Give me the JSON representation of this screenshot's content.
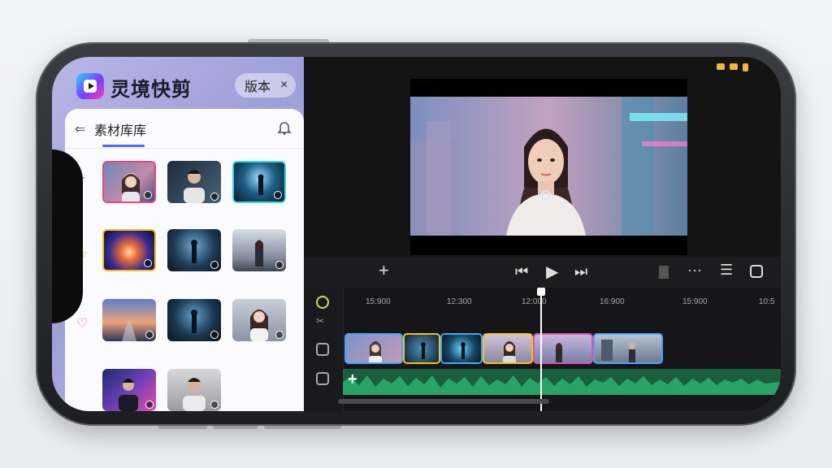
{
  "app": {
    "title": "灵境快剪",
    "badge": "版本",
    "close_glyph": "×",
    "logo_icon": "play-logo-icon"
  },
  "library": {
    "back_glyph": "⇐",
    "title": "素材库库",
    "notify_icon": "bell-icon",
    "thumbnails": [
      {
        "row": 0,
        "col": 0,
        "subject": "woman-portrait",
        "border": "#e9477c"
      },
      {
        "row": 0,
        "col": 1,
        "subject": "man-portrait",
        "border": ""
      },
      {
        "row": 0,
        "col": 2,
        "subject": "figure-neon",
        "border": "#39d6e8"
      },
      {
        "row": 1,
        "col": 0,
        "subject": "light-burst",
        "border": "#f2c21b"
      },
      {
        "row": 1,
        "col": 1,
        "subject": "figure-tunnel",
        "border": ""
      },
      {
        "row": 1,
        "col": 2,
        "subject": "woman-street",
        "border": ""
      },
      {
        "row": 2,
        "col": 0,
        "subject": "road-sunset",
        "border": ""
      },
      {
        "row": 2,
        "col": 1,
        "subject": "figure-tunnel-2",
        "border": ""
      },
      {
        "row": 2,
        "col": 2,
        "subject": "woman-smile",
        "border": ""
      },
      {
        "row": 3,
        "col": 0,
        "subject": "man-headset",
        "border": ""
      },
      {
        "row": 3,
        "col": 1,
        "subject": "man-studio",
        "border": ""
      }
    ]
  },
  "status_colors": {
    "accent": "#f3b63a"
  },
  "controls": {
    "add_glyph": "+",
    "rewind_glyph": "⏮",
    "play_glyph": "▶",
    "forward_glyph": "⏭",
    "more_glyph": "···",
    "list_glyph": "☰"
  },
  "timeline": {
    "ticks": [
      "15:900",
      "12:300",
      "12:000",
      "16:900",
      "15:900",
      "10:5"
    ],
    "clips": [
      {
        "subject": "woman",
        "border": "#4aa3ff"
      },
      {
        "subject": "figure-dark",
        "border": "#f2c21b"
      },
      {
        "subject": "figure-tunnel",
        "border": "#4aa3ff"
      },
      {
        "subject": "woman-glasses",
        "border": "#f2c21b"
      },
      {
        "subject": "woman-city",
        "border": "#e14fb6"
      },
      {
        "subject": "man-road",
        "border": "#4aa3ff"
      }
    ],
    "audio_add_glyph": "+",
    "playhead_time": "12:000"
  }
}
